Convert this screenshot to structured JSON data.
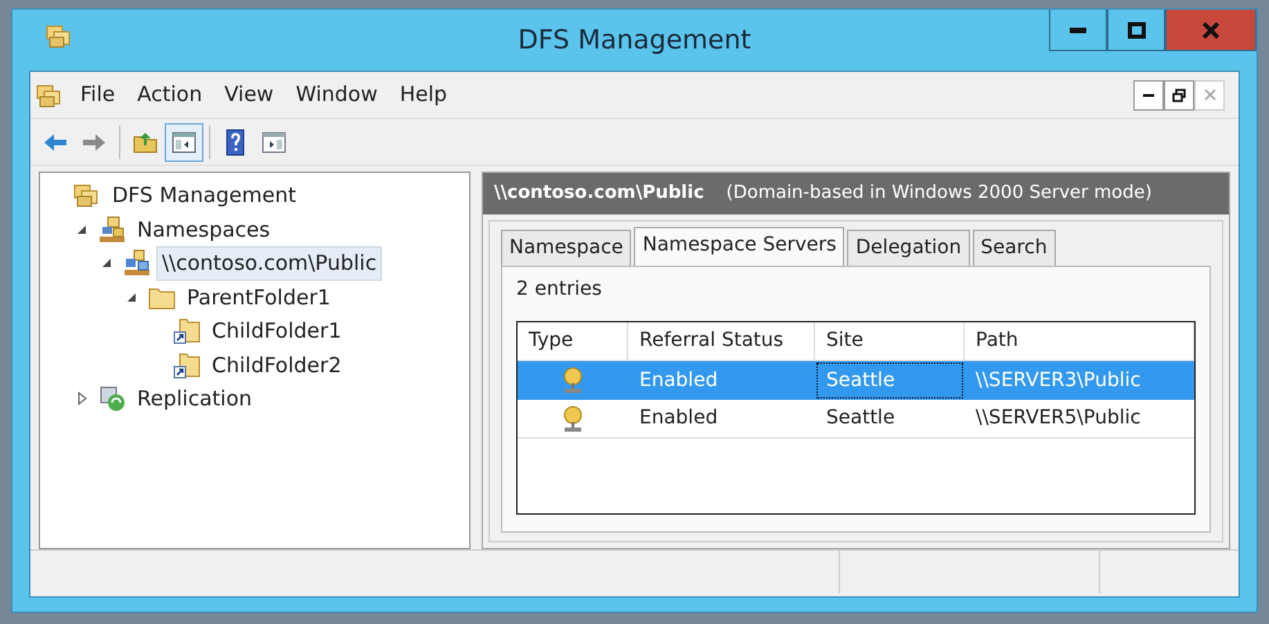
{
  "window": {
    "title": "DFS Management"
  },
  "menu": [
    "File",
    "Action",
    "View",
    "Window",
    "Help"
  ],
  "toolbar": [
    {
      "kind": "back",
      "disabled": false,
      "pressed": false
    },
    {
      "kind": "forward",
      "disabled": true,
      "pressed": false
    },
    {
      "kind": "separator"
    },
    {
      "kind": "up",
      "disabled": false,
      "pressed": false
    },
    {
      "kind": "tree",
      "pressed": true
    },
    {
      "kind": "separator"
    },
    {
      "kind": "help",
      "pressed": false
    },
    {
      "kind": "pane",
      "pressed": false
    }
  ],
  "tree": [
    {
      "label": "DFS Management",
      "kind": "root",
      "selected": false,
      "children": [
        {
          "label": "Namespaces",
          "kind": "namespaces",
          "expanded": true,
          "selected": false,
          "children": [
            {
              "label": "\\\\contoso.com\\Public",
              "kind": "namespace",
              "expanded": true,
              "selected": true,
              "children": [
                {
                  "label": "ParentFolder1",
                  "kind": "folder",
                  "expanded": true,
                  "selected": false,
                  "children": [
                    {
                      "label": "ChildFolder1",
                      "kind": "link",
                      "selected": false
                    },
                    {
                      "label": "ChildFolder2",
                      "kind": "link",
                      "selected": false
                    }
                  ]
                }
              ]
            }
          ]
        },
        {
          "label": "Replication",
          "kind": "replication",
          "expanded": false,
          "selected": false
        }
      ]
    }
  ],
  "details": {
    "path": "\\\\contoso.com\\Public",
    "mode": "(Domain-based in Windows 2000 Server mode)",
    "tabs": [
      {
        "label": "Namespace",
        "selected": false
      },
      {
        "label": "Namespace Servers",
        "selected": true
      },
      {
        "label": "Delegation",
        "selected": false
      },
      {
        "label": "Search",
        "selected": false
      }
    ],
    "entries": "2 entries",
    "table": {
      "columns": [
        "Type",
        "Referral Status",
        "Site",
        "Path"
      ],
      "rows": [
        {
          "referral_status": "Enabled",
          "site": "Seattle",
          "path": "\\\\SERVER3\\Public",
          "selected": true,
          "site_focused": true
        },
        {
          "referral_status": "Enabled",
          "site": "Seattle",
          "path": "\\\\SERVER5\\Public",
          "selected": false,
          "site_focused": false
        }
      ]
    }
  }
}
